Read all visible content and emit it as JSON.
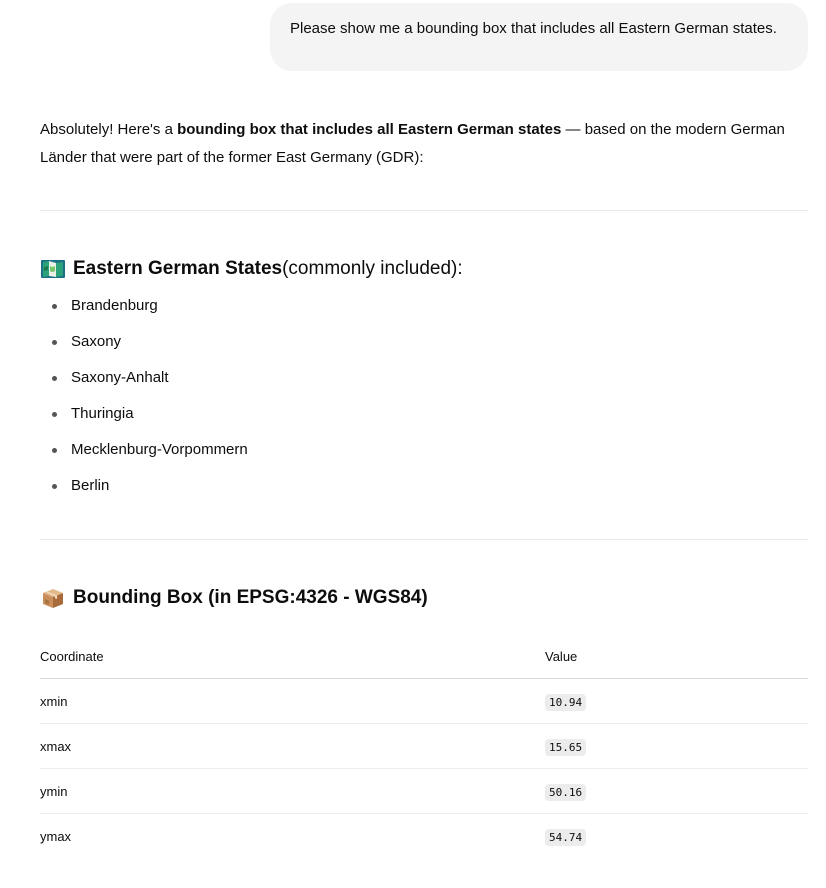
{
  "user_message": {
    "text": "Please show me a bounding box that includes all Eastern German states."
  },
  "assistant": {
    "intro": {
      "part1": "Absolutely! Here's a ",
      "bold": "bounding box that includes all Eastern German states",
      "part2": " — based on the modern German Länder that were part of the former East Germany (GDR):"
    },
    "states_section": {
      "icon": "map-icon",
      "title_bold": "Eastern German States",
      "title_rest": " (commonly included):",
      "items": [
        "Brandenburg",
        "Saxony",
        "Saxony-Anhalt",
        "Thuringia",
        "Mecklenburg-Vorpommern",
        "Berlin"
      ]
    },
    "bbox_section": {
      "icon": "package-icon",
      "title": "Bounding Box (in EPSG:4326 - WGS84)",
      "table": {
        "headers": [
          "Coordinate",
          "Value"
        ],
        "rows": [
          [
            "xmin",
            "10.94"
          ],
          [
            "xmax",
            "15.65"
          ],
          [
            "ymin",
            "50.16"
          ],
          [
            "ymax",
            "54.74"
          ]
        ]
      }
    }
  },
  "colors": {
    "bubble_bg": "#f4f4f4",
    "divider": "#e8e8e8",
    "code_bg": "#ececec",
    "text": "#0d0d0d"
  }
}
